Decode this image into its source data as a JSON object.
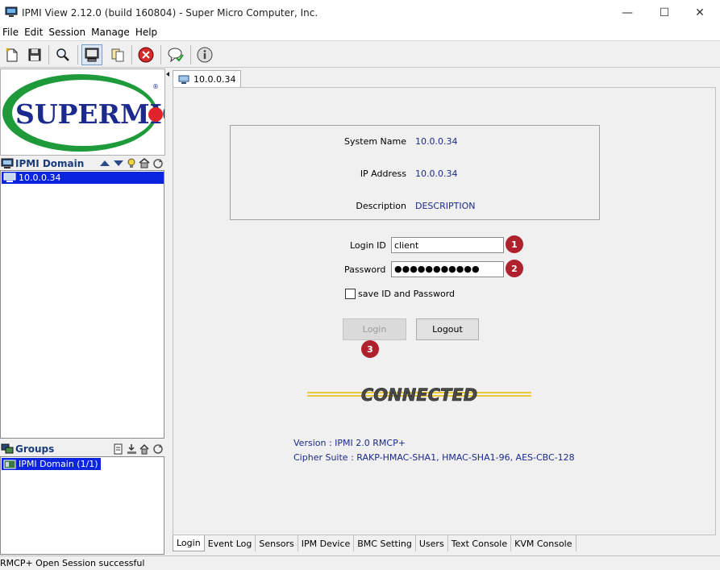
{
  "window": {
    "title": "IPMI View 2.12.0 (build 160804) - Super Micro Computer, Inc.",
    "minimize": "—",
    "maximize": "☐",
    "close": "✕"
  },
  "menu": [
    "File",
    "Edit",
    "Session",
    "Manage",
    "Help"
  ],
  "toolbar_icons": [
    "new-icon",
    "save-icon",
    "search-icon",
    "monitor-icon",
    "copy-icon",
    "stop-icon",
    "chat-icon",
    "info-icon"
  ],
  "logo": {
    "text": "SUPERMICR",
    "registered": "®",
    "brand_green": "#1f9a3a",
    "brand_blue": "#1b2a8c",
    "brand_red": "#e0232b"
  },
  "ipmi_domain": {
    "header": "IPMI Domain",
    "items": [
      "10.0.0.34"
    ]
  },
  "groups": {
    "header": "Groups",
    "items": [
      "IPMI Domain (1/1)"
    ]
  },
  "tab": {
    "label": "10.0.0.34"
  },
  "system_info": {
    "system_name_label": "System Name",
    "system_name": "10.0.0.34",
    "ip_label": "IP Address",
    "ip": "10.0.0.34",
    "description_label": "Description",
    "description": "DESCRIPTION"
  },
  "login_form": {
    "login_id_label": "Login ID",
    "login_id": "client",
    "password_label": "Password",
    "password": "●●●●●●●●●●●",
    "save_label": "save ID and Password",
    "login_button": "Login",
    "logout_button": "Logout",
    "badges": [
      "1",
      "2",
      "3"
    ]
  },
  "connected_text": "CONNECTED",
  "version": {
    "version_line": "Version : IPMI 2.0 RMCP+",
    "cipher_line": "Cipher Suite : RAKP-HMAC-SHA1, HMAC-SHA1-96, AES-CBC-128"
  },
  "bottom_tabs": [
    "Login",
    "Event Log",
    "Sensors",
    "IPM Device",
    "BMC Setting",
    "Users",
    "Text Console",
    "KVM Console"
  ],
  "status": "RMCP+ Open Session successful",
  "colors": {
    "selection": "#0a24e0",
    "badge": "#b0212e",
    "value_text": "#1a2a8a"
  }
}
